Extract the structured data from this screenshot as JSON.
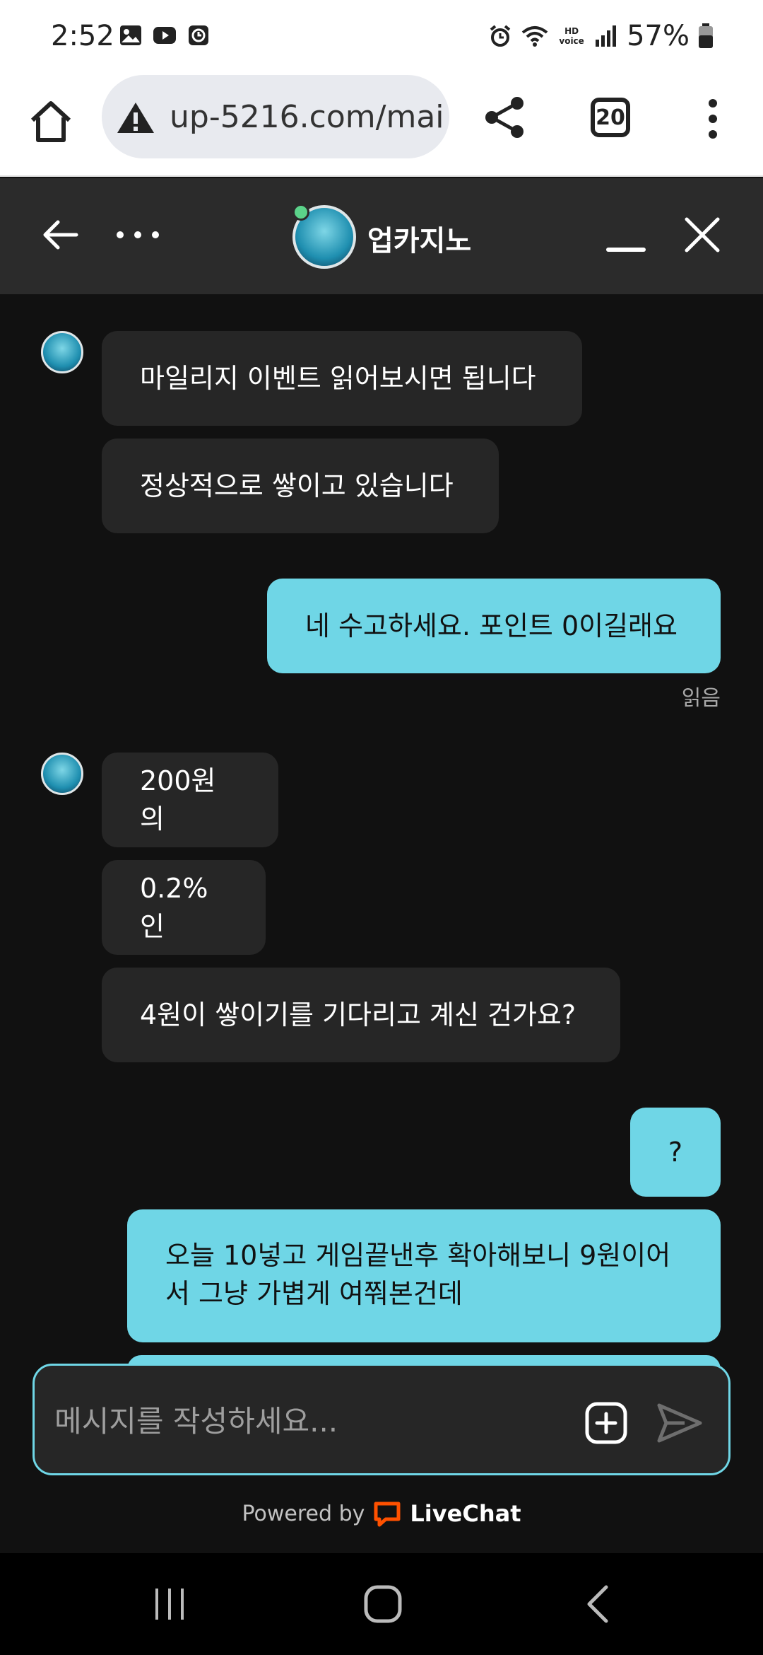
{
  "status_bar": {
    "time": "2:52",
    "battery": "57%",
    "network_label": "HD voice"
  },
  "browser": {
    "url": "up-5216.com/mai",
    "tab_count": "20"
  },
  "chat_header": {
    "title": "업카지노"
  },
  "messages": [
    {
      "from": "agent",
      "text": "마일리지 이벤트 읽어보시면 됩니다"
    },
    {
      "from": "agent",
      "text": "정상적으로 쌓이고 있습니다"
    },
    {
      "from": "user",
      "text": "네 수고하세요. 포인트 0이길래요"
    },
    {
      "from": "agent",
      "text": "200원의"
    },
    {
      "from": "agent",
      "text": "0.2%인"
    },
    {
      "from": "agent",
      "text": "4원이 쌓이기를 기다리고 계신 건가요?"
    },
    {
      "from": "user",
      "text": "?"
    },
    {
      "from": "user",
      "text": "오늘 10넣고 게임끝낸후 확아해보니 9원이어\n서 그냥 가볍게 여쭤본건데"
    }
  ],
  "read_receipt": "읽음",
  "composer": {
    "placeholder": "메시지를 작성하세요..."
  },
  "footer": {
    "powered_by": "Powered by",
    "brand": "LiveChat",
    "brand_color": "#ff5100"
  },
  "colors": {
    "accent": "#6fd6e6",
    "background": "#111111",
    "agent_bubble": "#262626",
    "header": "#2b2b2b"
  }
}
